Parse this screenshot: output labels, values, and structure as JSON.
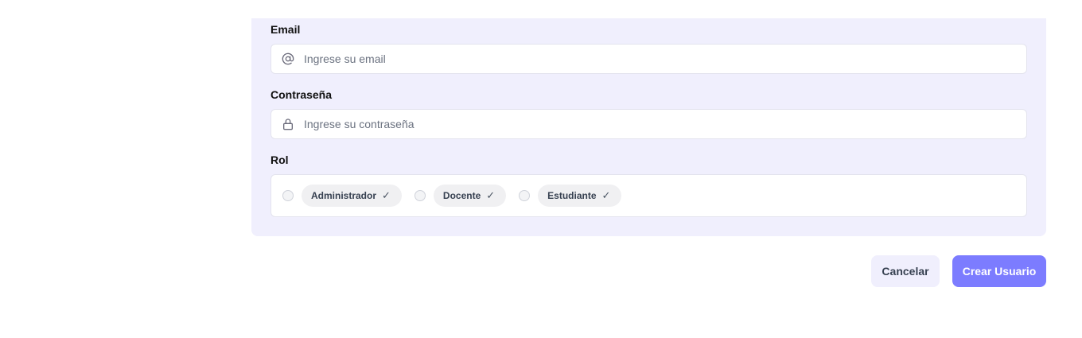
{
  "form": {
    "email": {
      "label": "Email",
      "placeholder": "Ingrese su email",
      "value": ""
    },
    "password": {
      "label": "Contraseña",
      "placeholder": "Ingrese su contraseña",
      "value": ""
    },
    "role": {
      "label": "Rol",
      "options": [
        {
          "label": "Administrador",
          "check": "✓"
        },
        {
          "label": "Docente",
          "check": "✓"
        },
        {
          "label": "Estudiante",
          "check": "✓"
        }
      ]
    }
  },
  "actions": {
    "cancel_label": "Cancelar",
    "create_label": "Crear Usuario"
  },
  "colors": {
    "accent": "#7c7cff",
    "panel_bg": "#f0effd"
  }
}
